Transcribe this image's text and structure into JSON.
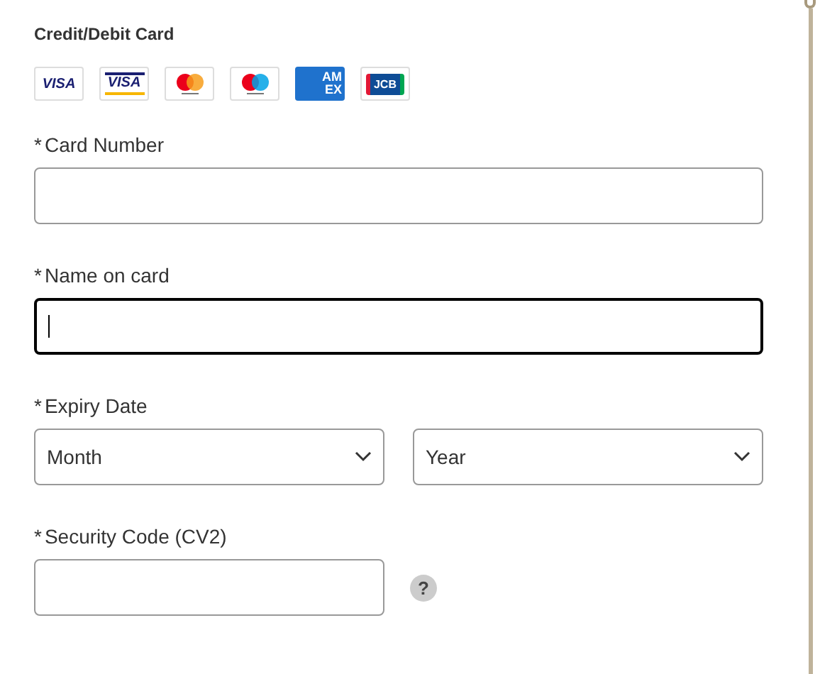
{
  "section_title": "Credit/Debit Card",
  "card_logos": [
    {
      "kind": "visa",
      "label": "VISA"
    },
    {
      "kind": "visa-electron",
      "label": "VISA"
    },
    {
      "kind": "mastercard"
    },
    {
      "kind": "maestro"
    },
    {
      "kind": "amex",
      "label": "AM EX"
    },
    {
      "kind": "jcb",
      "label": "JCB"
    }
  ],
  "fields": [
    {
      "kind": "text",
      "required_mark": "*",
      "label": "Card Number",
      "focused": false
    },
    {
      "kind": "text",
      "required_mark": "*",
      "label": "Name on card",
      "focused": true
    },
    {
      "kind": "selects",
      "required_mark": "*",
      "label": "Expiry Date",
      "options": [
        {
          "value": "Month"
        },
        {
          "value": "Year"
        }
      ]
    },
    {
      "kind": "help",
      "required_mark": "*",
      "label": "Security Code (CV2)",
      "focused": false,
      "help": "?"
    }
  ]
}
